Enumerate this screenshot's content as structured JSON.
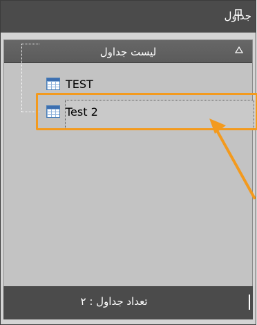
{
  "panel": {
    "title": "جداول"
  },
  "group": {
    "label": "لیست جداول"
  },
  "tables": [
    {
      "name": "TEST"
    },
    {
      "name": "Test 2",
      "selected": true
    }
  ],
  "footer": {
    "count_label": "تعداد جداول : ۲"
  },
  "colors": {
    "highlight": "#f39a1e",
    "titlebar": "#4b4b4b",
    "panel_bg": "#c3c3c3"
  },
  "icons": {
    "pin": "pin-icon",
    "collapse": "collapse-icon",
    "table": "table-icon"
  }
}
